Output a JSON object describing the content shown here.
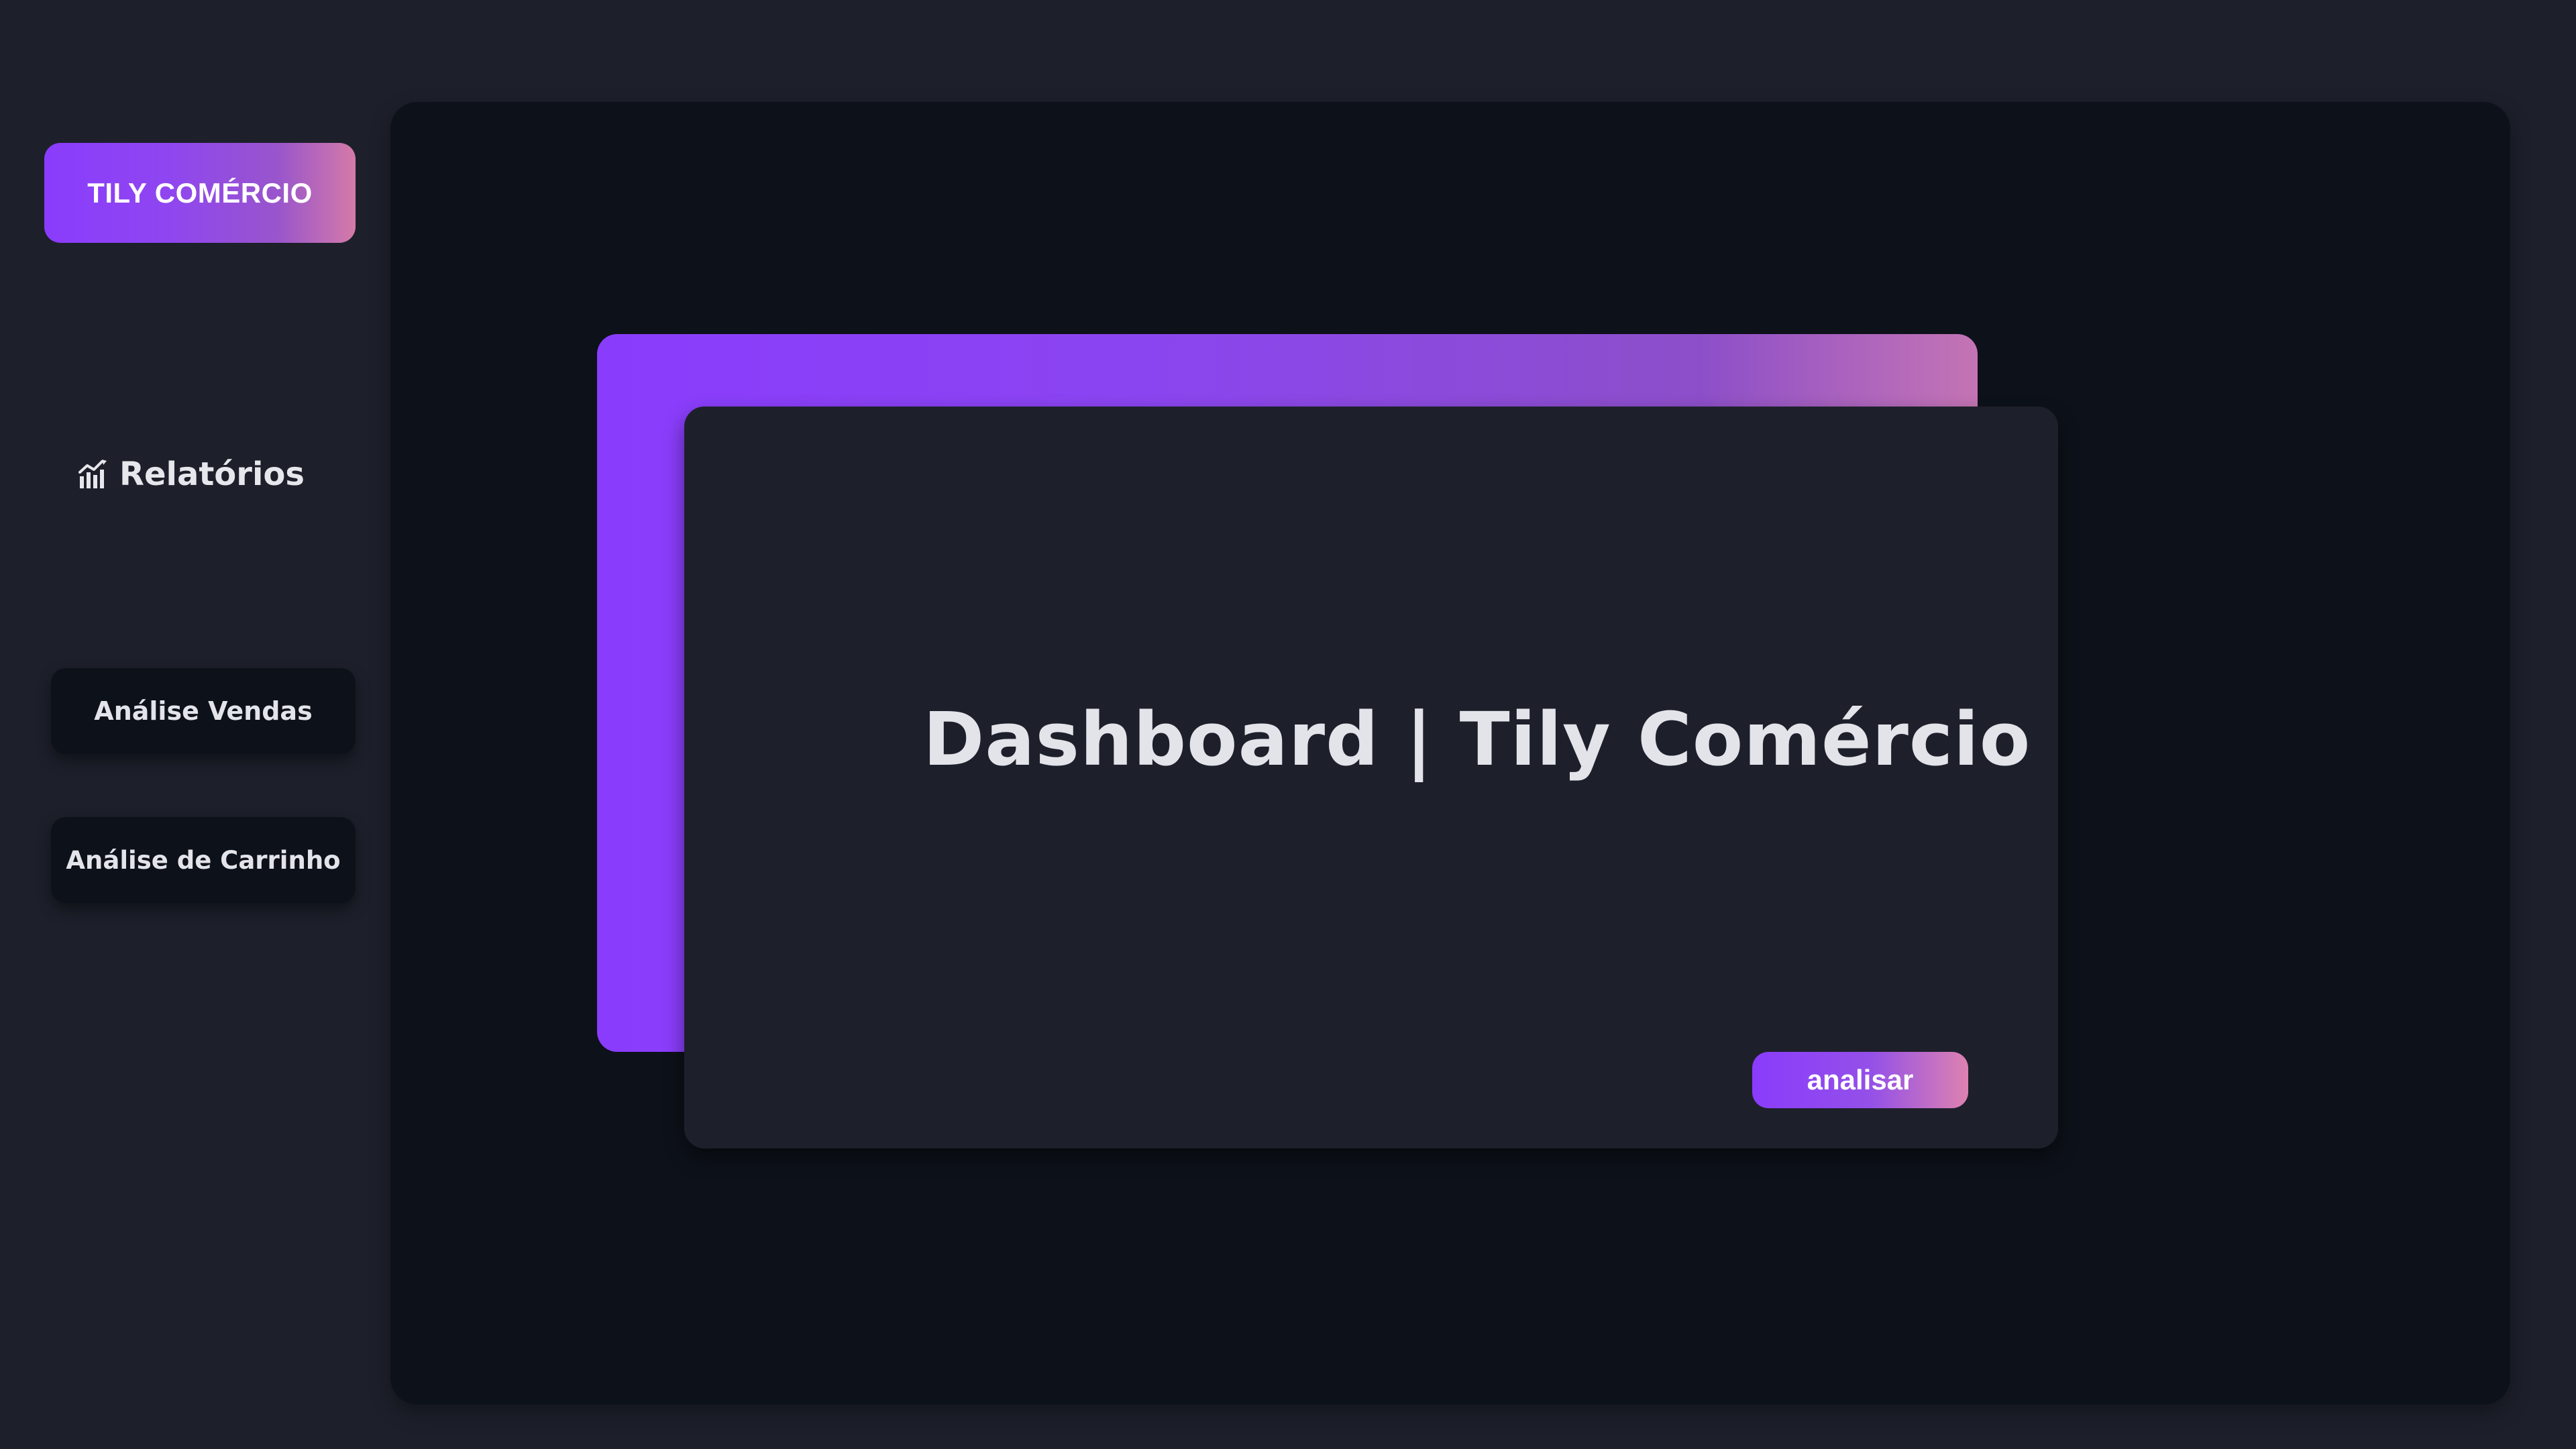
{
  "sidebar": {
    "brand_label": "TILY COMÉRCIO",
    "reports": {
      "label": "Relatórios",
      "icon": "bar-chart-icon"
    },
    "buttons": [
      {
        "label": "Análise Vendas"
      },
      {
        "label": "Análise de Carrinho"
      }
    ]
  },
  "main": {
    "card": {
      "title": "Dashboard | Tily Comércio",
      "action_label": "analisar"
    }
  },
  "colors": {
    "background": "#1d202b",
    "panel": "#0d1119",
    "accent_start": "#8a3cfc",
    "accent_end": "#d47aa8",
    "text": "#e3e4ea"
  }
}
